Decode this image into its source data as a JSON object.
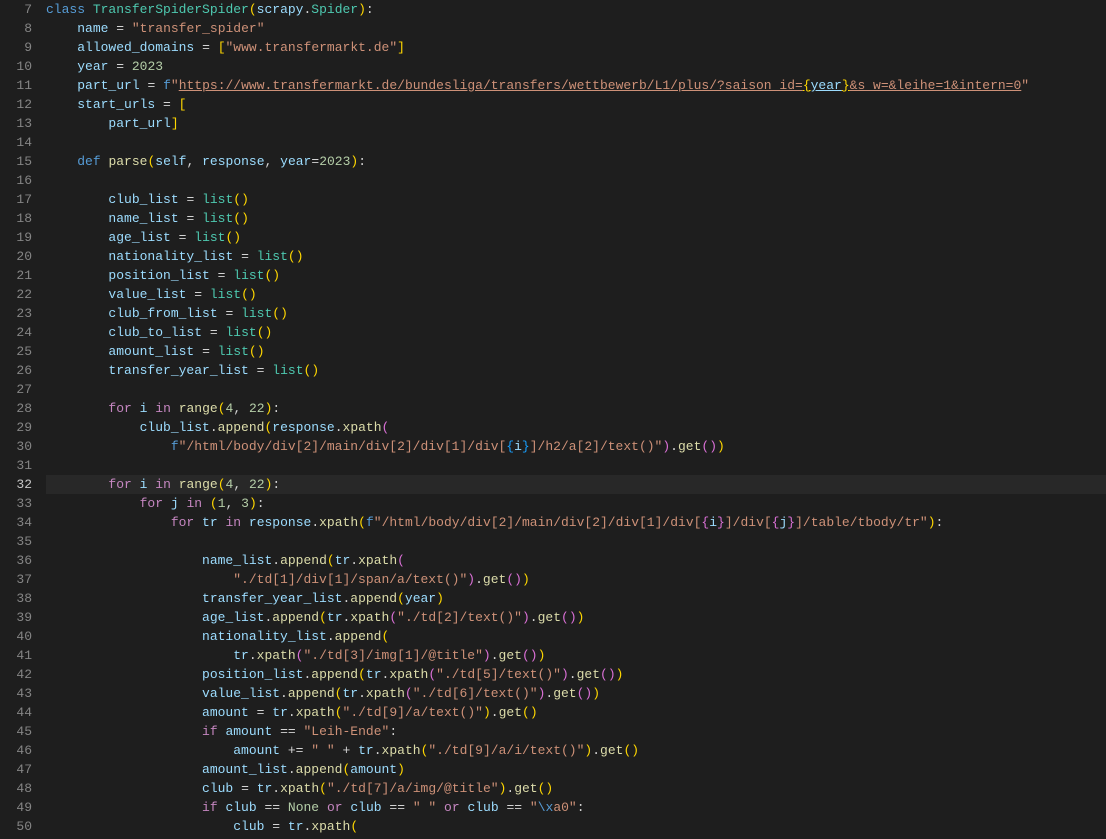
{
  "first_line_number": 7,
  "active_line_number": 32,
  "lines": [
    {
      "n": 7,
      "html": "<span class='kw'>class</span> <span class='cls'>TransferSpiderSpider</span><span class='br1'>(</span><span class='var'>scrapy</span><span class='op'>.</span><span class='cls'>Spider</span><span class='br1'>)</span><span class='op'>:</span>"
    },
    {
      "n": 8,
      "html": "    <span class='var'>name</span> <span class='op'>=</span> <span class='str'>\"transfer_spider\"</span>"
    },
    {
      "n": 9,
      "html": "    <span class='var'>allowed_domains</span> <span class='op'>=</span> <span class='br1'>[</span><span class='str'>\"www.transfermarkt.de\"</span><span class='br1'>]</span>"
    },
    {
      "n": 10,
      "html": "    <span class='var'>year</span> <span class='op'>=</span> <span class='num'>2023</span>"
    },
    {
      "n": 11,
      "html": "    <span class='var'>part_url</span> <span class='op'>=</span> <span class='kw'>f</span><span class='str'>\"<span class='u'>https://www.transfermarkt.de/bundesliga/transfers/wettbewerb/L1/plus/?saison_id=</span></span><span class='br1 u'>{</span><span class='var u'>year</span><span class='br1 u'>}</span><span class='str u'>&amp;s_w=&amp;leihe=1&amp;intern=0</span><span class='str'>\"</span>"
    },
    {
      "n": 12,
      "html": "    <span class='var'>start_urls</span> <span class='op'>=</span> <span class='br1'>[</span>"
    },
    {
      "n": 13,
      "html": "        <span class='var'>part_url</span><span class='br1'>]</span>"
    },
    {
      "n": 14,
      "html": ""
    },
    {
      "n": 15,
      "html": "    <span class='kw'>def</span> <span class='fn'>parse</span><span class='br1'>(</span><span class='sf'>self</span><span class='op'>,</span> <span class='var'>response</span><span class='op'>,</span> <span class='var'>year</span><span class='op'>=</span><span class='num'>2023</span><span class='br1'>)</span><span class='op'>:</span>"
    },
    {
      "n": 16,
      "html": ""
    },
    {
      "n": 17,
      "html": "        <span class='var'>club_list</span> <span class='op'>=</span> <span class='cls'>list</span><span class='br1'>()</span>"
    },
    {
      "n": 18,
      "html": "        <span class='var'>name_list</span> <span class='op'>=</span> <span class='cls'>list</span><span class='br1'>()</span>"
    },
    {
      "n": 19,
      "html": "        <span class='var'>age_list</span> <span class='op'>=</span> <span class='cls'>list</span><span class='br1'>()</span>"
    },
    {
      "n": 20,
      "html": "        <span class='var'>nationality_list</span> <span class='op'>=</span> <span class='cls'>list</span><span class='br1'>()</span>"
    },
    {
      "n": 21,
      "html": "        <span class='var'>position_list</span> <span class='op'>=</span> <span class='cls'>list</span><span class='br1'>()</span>"
    },
    {
      "n": 22,
      "html": "        <span class='var'>value_list</span> <span class='op'>=</span> <span class='cls'>list</span><span class='br1'>()</span>"
    },
    {
      "n": 23,
      "html": "        <span class='var'>club_from_list</span> <span class='op'>=</span> <span class='cls'>list</span><span class='br1'>()</span>"
    },
    {
      "n": 24,
      "html": "        <span class='var'>club_to_list</span> <span class='op'>=</span> <span class='cls'>list</span><span class='br1'>()</span>"
    },
    {
      "n": 25,
      "html": "        <span class='var'>amount_list</span> <span class='op'>=</span> <span class='cls'>list</span><span class='br1'>()</span>"
    },
    {
      "n": 26,
      "html": "        <span class='var'>transfer_year_list</span> <span class='op'>=</span> <span class='cls'>list</span><span class='br1'>()</span>"
    },
    {
      "n": 27,
      "html": ""
    },
    {
      "n": 28,
      "html": "        <span class='ctl'>for</span> <span class='var'>i</span> <span class='ctl'>in</span> <span class='fn'>range</span><span class='br1'>(</span><span class='num'>4</span><span class='op'>,</span> <span class='num'>22</span><span class='br1'>)</span><span class='op'>:</span>"
    },
    {
      "n": 29,
      "html": "            <span class='var'>club_list</span><span class='op'>.</span><span class='fn'>append</span><span class='br1'>(</span><span class='var'>response</span><span class='op'>.</span><span class='fn'>xpath</span><span class='br2'>(</span>"
    },
    {
      "n": 30,
      "html": "                <span class='kw'>f</span><span class='str'>\"/html/body/div[2]/main/div[2]/div[1]/div[</span><span class='br3'>{</span><span class='var'>i</span><span class='br3'>}</span><span class='str'>]/h2/a[2]/text()\"</span><span class='br2'>)</span><span class='op'>.</span><span class='fn'>get</span><span class='br2'>(</span><span class='br2'>)</span><span class='br1'>)</span>"
    },
    {
      "n": 31,
      "html": ""
    },
    {
      "n": 32,
      "html": "        <span class='ctl'>for</span> <span class='var'>i</span> <span class='ctl'>in</span> <span class='fn'>range</span><span class='br1'>(</span><span class='num'>4</span><span class='op'>,</span> <span class='num'>22</span><span class='br1'>)</span><span class='op'>:</span>"
    },
    {
      "n": 33,
      "html": "            <span class='ctl'>for</span> <span class='var'>j</span> <span class='ctl'>in</span> <span class='br1'>(</span><span class='num'>1</span><span class='op'>,</span> <span class='num'>3</span><span class='br1'>)</span><span class='op'>:</span>"
    },
    {
      "n": 34,
      "html": "                <span class='ctl'>for</span> <span class='var'>tr</span> <span class='ctl'>in</span> <span class='var'>response</span><span class='op'>.</span><span class='fn'>xpath</span><span class='br1'>(</span><span class='kw'>f</span><span class='str'>\"/html/body/div[2]/main/div[2]/div[1]/div[</span><span class='br2'>{</span><span class='var'>i</span><span class='br2'>}</span><span class='str'>]/div[</span><span class='br2'>{</span><span class='var'>j</span><span class='br2'>}</span><span class='str'>]/table/tbody/tr\"</span><span class='br1'>)</span><span class='op'>:</span>"
    },
    {
      "n": 35,
      "html": ""
    },
    {
      "n": 36,
      "html": "                    <span class='var'>name_list</span><span class='op'>.</span><span class='fn'>append</span><span class='br1'>(</span><span class='var'>tr</span><span class='op'>.</span><span class='fn'>xpath</span><span class='br2'>(</span>"
    },
    {
      "n": 37,
      "html": "                        <span class='str'>\"./td[1]/div[1]/span/a/text()\"</span><span class='br2'>)</span><span class='op'>.</span><span class='fn'>get</span><span class='br2'>(</span><span class='br2'>)</span><span class='br1'>)</span>"
    },
    {
      "n": 38,
      "html": "                    <span class='var'>transfer_year_list</span><span class='op'>.</span><span class='fn'>append</span><span class='br1'>(</span><span class='var'>year</span><span class='br1'>)</span>"
    },
    {
      "n": 39,
      "html": "                    <span class='var'>age_list</span><span class='op'>.</span><span class='fn'>append</span><span class='br1'>(</span><span class='var'>tr</span><span class='op'>.</span><span class='fn'>xpath</span><span class='br2'>(</span><span class='str'>\"./td[2]/text()\"</span><span class='br2'>)</span><span class='op'>.</span><span class='fn'>get</span><span class='br2'>(</span><span class='br2'>)</span><span class='br1'>)</span>"
    },
    {
      "n": 40,
      "html": "                    <span class='var'>nationality_list</span><span class='op'>.</span><span class='fn'>append</span><span class='br1'>(</span>"
    },
    {
      "n": 41,
      "html": "                        <span class='var'>tr</span><span class='op'>.</span><span class='fn'>xpath</span><span class='br2'>(</span><span class='str'>\"./td[3]/img[1]/@title\"</span><span class='br2'>)</span><span class='op'>.</span><span class='fn'>get</span><span class='br2'>(</span><span class='br2'>)</span><span class='br1'>)</span>"
    },
    {
      "n": 42,
      "html": "                    <span class='var'>position_list</span><span class='op'>.</span><span class='fn'>append</span><span class='br1'>(</span><span class='var'>tr</span><span class='op'>.</span><span class='fn'>xpath</span><span class='br2'>(</span><span class='str'>\"./td[5]/text()\"</span><span class='br2'>)</span><span class='op'>.</span><span class='fn'>get</span><span class='br2'>(</span><span class='br2'>)</span><span class='br1'>)</span>"
    },
    {
      "n": 43,
      "html": "                    <span class='var'>value_list</span><span class='op'>.</span><span class='fn'>append</span><span class='br1'>(</span><span class='var'>tr</span><span class='op'>.</span><span class='fn'>xpath</span><span class='br2'>(</span><span class='str'>\"./td[6]/text()\"</span><span class='br2'>)</span><span class='op'>.</span><span class='fn'>get</span><span class='br2'>(</span><span class='br2'>)</span><span class='br1'>)</span>"
    },
    {
      "n": 44,
      "html": "                    <span class='var'>amount</span> <span class='op'>=</span> <span class='var'>tr</span><span class='op'>.</span><span class='fn'>xpath</span><span class='br1'>(</span><span class='str'>\"./td[9]/a/text()\"</span><span class='br1'>)</span><span class='op'>.</span><span class='fn'>get</span><span class='br1'>(</span><span class='br1'>)</span>"
    },
    {
      "n": 45,
      "html": "                    <span class='ctl'>if</span> <span class='var'>amount</span> <span class='op'>==</span> <span class='str'>\"Leih-Ende\"</span><span class='op'>:</span>"
    },
    {
      "n": 46,
      "html": "                        <span class='var'>amount</span> <span class='op'>+=</span> <span class='str'>\" \"</span> <span class='op'>+</span> <span class='var'>tr</span><span class='op'>.</span><span class='fn'>xpath</span><span class='br1'>(</span><span class='str'>\"./td[9]/a/i/text()\"</span><span class='br1'>)</span><span class='op'>.</span><span class='fn'>get</span><span class='br1'>(</span><span class='br1'>)</span>"
    },
    {
      "n": 47,
      "html": "                    <span class='var'>amount_list</span><span class='op'>.</span><span class='fn'>append</span><span class='br1'>(</span><span class='var'>amount</span><span class='br1'>)</span>"
    },
    {
      "n": 48,
      "html": "                    <span class='var'>club</span> <span class='op'>=</span> <span class='var'>tr</span><span class='op'>.</span><span class='fn'>xpath</span><span class='br1'>(</span><span class='str'>\"./td[7]/a/img/@title\"</span><span class='br1'>)</span><span class='op'>.</span><span class='fn'>get</span><span class='br1'>(</span><span class='br1'>)</span>"
    },
    {
      "n": 49,
      "html": "                    <span class='ctl'>if</span> <span class='var'>club</span> <span class='op'>==</span> <span class='num'>None</span> <span class='ctl'>or</span> <span class='var'>club</span> <span class='op'>==</span> <span class='str'>\" \"</span> <span class='ctl'>or</span> <span class='var'>club</span> <span class='op'>==</span> <span class='str'>\"<span class='kw'>\\x</span>a0\"</span><span class='op'>:</span>"
    },
    {
      "n": 50,
      "html": "                        <span class='var'>club</span> <span class='op'>=</span> <span class='var'>tr</span><span class='op'>.</span><span class='fn'>xpath</span><span class='br1'>(</span>"
    }
  ]
}
